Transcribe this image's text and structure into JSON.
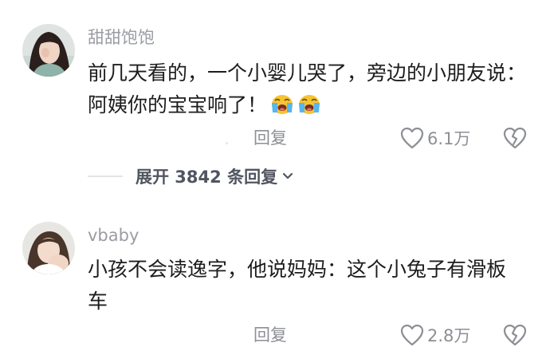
{
  "comments": [
    {
      "username": "甜甜饱饱",
      "content_lines": [
        "前几天看的，一个小婴儿哭了，旁边的小朋友说：",
        "阿姨你的宝宝响了！"
      ],
      "emoji_names": [
        "loudly-crying-face",
        "loudly-crying-face"
      ],
      "reply_label": "回复",
      "like_count": "6.1万",
      "expand_label": "展开 3842 条回复"
    },
    {
      "username": "vbaby",
      "content_lines": [
        "小孩不会读逸字，他说妈妈：这个小兔子有滑板",
        "车"
      ],
      "reply_label": "回复",
      "like_count": "2.8万"
    }
  ],
  "icons": {
    "like": "heart-outline-icon",
    "dislike": "broken-heart-icon",
    "expand": "chevron-down-icon"
  },
  "colors": {
    "text": "#1d1d1f",
    "username": "#9a9ca3",
    "secondary": "#8d8f95",
    "expand_text": "#505560",
    "emoji_face": "#f6c431",
    "tears": "#57b6ef"
  }
}
